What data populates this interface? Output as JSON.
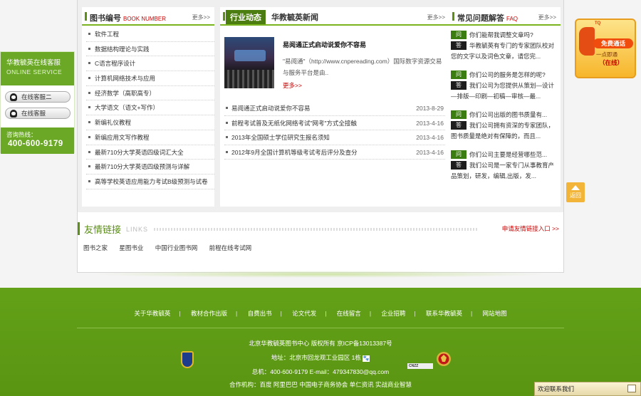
{
  "books": {
    "title": "图书编号",
    "title_en": "BOOK NUMBER",
    "more": "更多>>",
    "items": [
      "软件工程",
      "数据结构理论与实践",
      "C语言程序设计",
      "计算机网络技术与应用",
      "经济数学（高职高专）",
      "大学语文（语文+写作）",
      "新编礼仪教程",
      "新编应用文写作教程",
      "最新710分大学英语四级词汇大全",
      "最新710分大学英语四级预测与详解",
      "高等学校英语应用能力考试B级预测与试卷"
    ]
  },
  "news": {
    "tab_active": "行业动态",
    "tab_other": "华教毓英新闻",
    "more": "更多>>",
    "feature": {
      "title": "易阅通正式启动说爱你不容易",
      "desc": "\"易阅通\"（http://www.cnpereading.com）国际数字资源交易与服务平台是由..",
      "more": "更多>>"
    },
    "items": [
      {
        "title": "易阅通正式启动说爱你不容易",
        "date": "2013-8-29"
      },
      {
        "title": "前程考试普及无纸化网络考试\"网考\"方式全接触",
        "date": "2013-4-16"
      },
      {
        "title": "2013年全国硕士学位研究生报名须知",
        "date": "2013-4-16"
      },
      {
        "title": "2012年9月全国计算机等级考试考后评分及查分",
        "date": "2013-4-16"
      }
    ]
  },
  "faq": {
    "title": "常见问题解答",
    "title_en": "FAQ",
    "more": "更多>>",
    "q_tag": "问",
    "a_tag": "答",
    "items": [
      {
        "q": "你们能帮我调整文章吗?",
        "a1": "华教毓英有专门的专家团队校对",
        "a2": "您的文字以及词色文章，请您完..."
      },
      {
        "q": "你们公司的服务是怎样的呢?",
        "a1": "我们公司为您提供从策划—设计",
        "a2": "—排版—印刷—初稿—审核—最..."
      },
      {
        "q": "你们公司出版的图书质量有...",
        "a1": "我们公司拥有资深的专家团队，",
        "a2": "图书质量是绝对有保障的，而且..."
      },
      {
        "q": "你们公司主要是经营哪些范...",
        "a1": "我们公司是一家专门从事教育产",
        "a2": "品策划，研发，编辑,出版，发..."
      }
    ]
  },
  "friend": {
    "title": "友情链接",
    "title_en": "LINKS",
    "apply": "申请友情链接入口 >>",
    "links": [
      "图书之家",
      "星图书业",
      "中国行业图书网",
      "前程在线考试网"
    ]
  },
  "footer": {
    "nav": [
      "关于华教毓英",
      "教材合作出版",
      "自费出书",
      "论文代发",
      "在线留言",
      "企业招聘",
      "联系华教毓英",
      "网站地图"
    ],
    "separator": "|",
    "copyright": "北京华教毓英图书中心  版权所有  京ICP备13013387号",
    "address": "地址：北京市回龙观工业园区 1栋",
    "contact": "总机：400-600-9179  E-mail：479347830@qq.com",
    "partners": "合作机构：百度 阿里巴巴 中国电子商务协会 单仁资讯 实战商业智慧",
    "cnzz": "CNZZ"
  },
  "service": {
    "title": "华教毓英在线客服",
    "title_en": "ONLINE SERVICE",
    "btn1": "在线客服二",
    "btn2": "在线客服",
    "hotline_label": "咨询热线：",
    "hotline": "400-600-9179"
  },
  "callback": {
    "badge": "TQ",
    "button": "免费通话",
    "line1": "一点即通",
    "line2": "（在线）"
  },
  "backtop": {
    "label": "返回"
  },
  "chatbar": {
    "label": "欢迎联系我们"
  }
}
